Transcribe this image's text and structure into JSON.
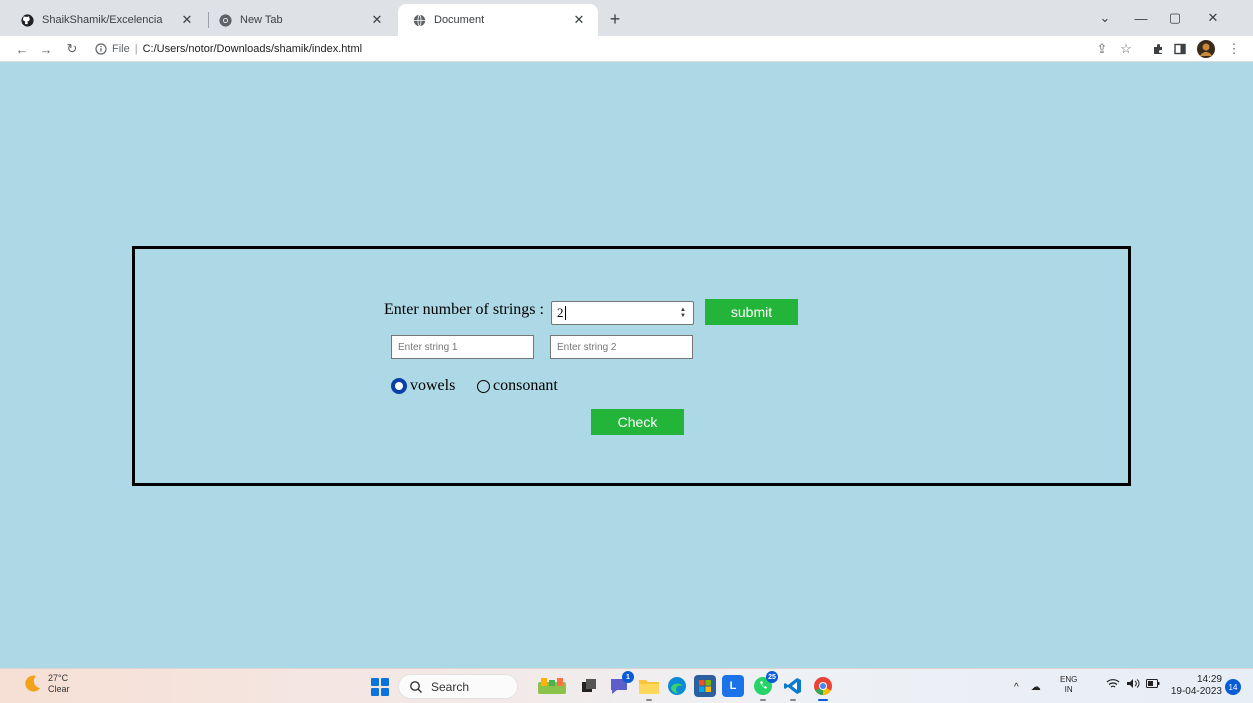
{
  "browser": {
    "tabs": [
      {
        "title": "ShaikShamik/Excelencia",
        "icon": "github-icon",
        "active": false
      },
      {
        "title": "New Tab",
        "icon": "chrome-icon",
        "active": false
      },
      {
        "title": "Document",
        "icon": "globe-icon",
        "active": true
      }
    ],
    "address": {
      "scheme_label": "File",
      "url": "C:/Users/notor/Downloads/shamik/index.html"
    }
  },
  "form": {
    "count_label": "Enter number of strings :",
    "count_value": "2",
    "submit_label": "submit",
    "string_placeholders": [
      "Enter string 1",
      "Enter string 2"
    ],
    "radio_options": [
      {
        "label": "vowels",
        "selected": true
      },
      {
        "label": "consonant",
        "selected": false
      }
    ],
    "check_label": "Check"
  },
  "taskbar": {
    "weather": {
      "temp": "27°C",
      "condition": "Clear"
    },
    "search_label": "Search",
    "badges": {
      "teams": "1",
      "whatsapp": "25"
    },
    "language": {
      "line1": "ENG",
      "line2": "IN"
    },
    "clock": {
      "time": "14:29",
      "date": "19-04-2023"
    },
    "notification_count": "14"
  },
  "colors": {
    "page_background": "#add8e6",
    "button_green": "#23b53a",
    "radio_selected": "#0b3fa8",
    "tabbar": "#dee1e6"
  }
}
